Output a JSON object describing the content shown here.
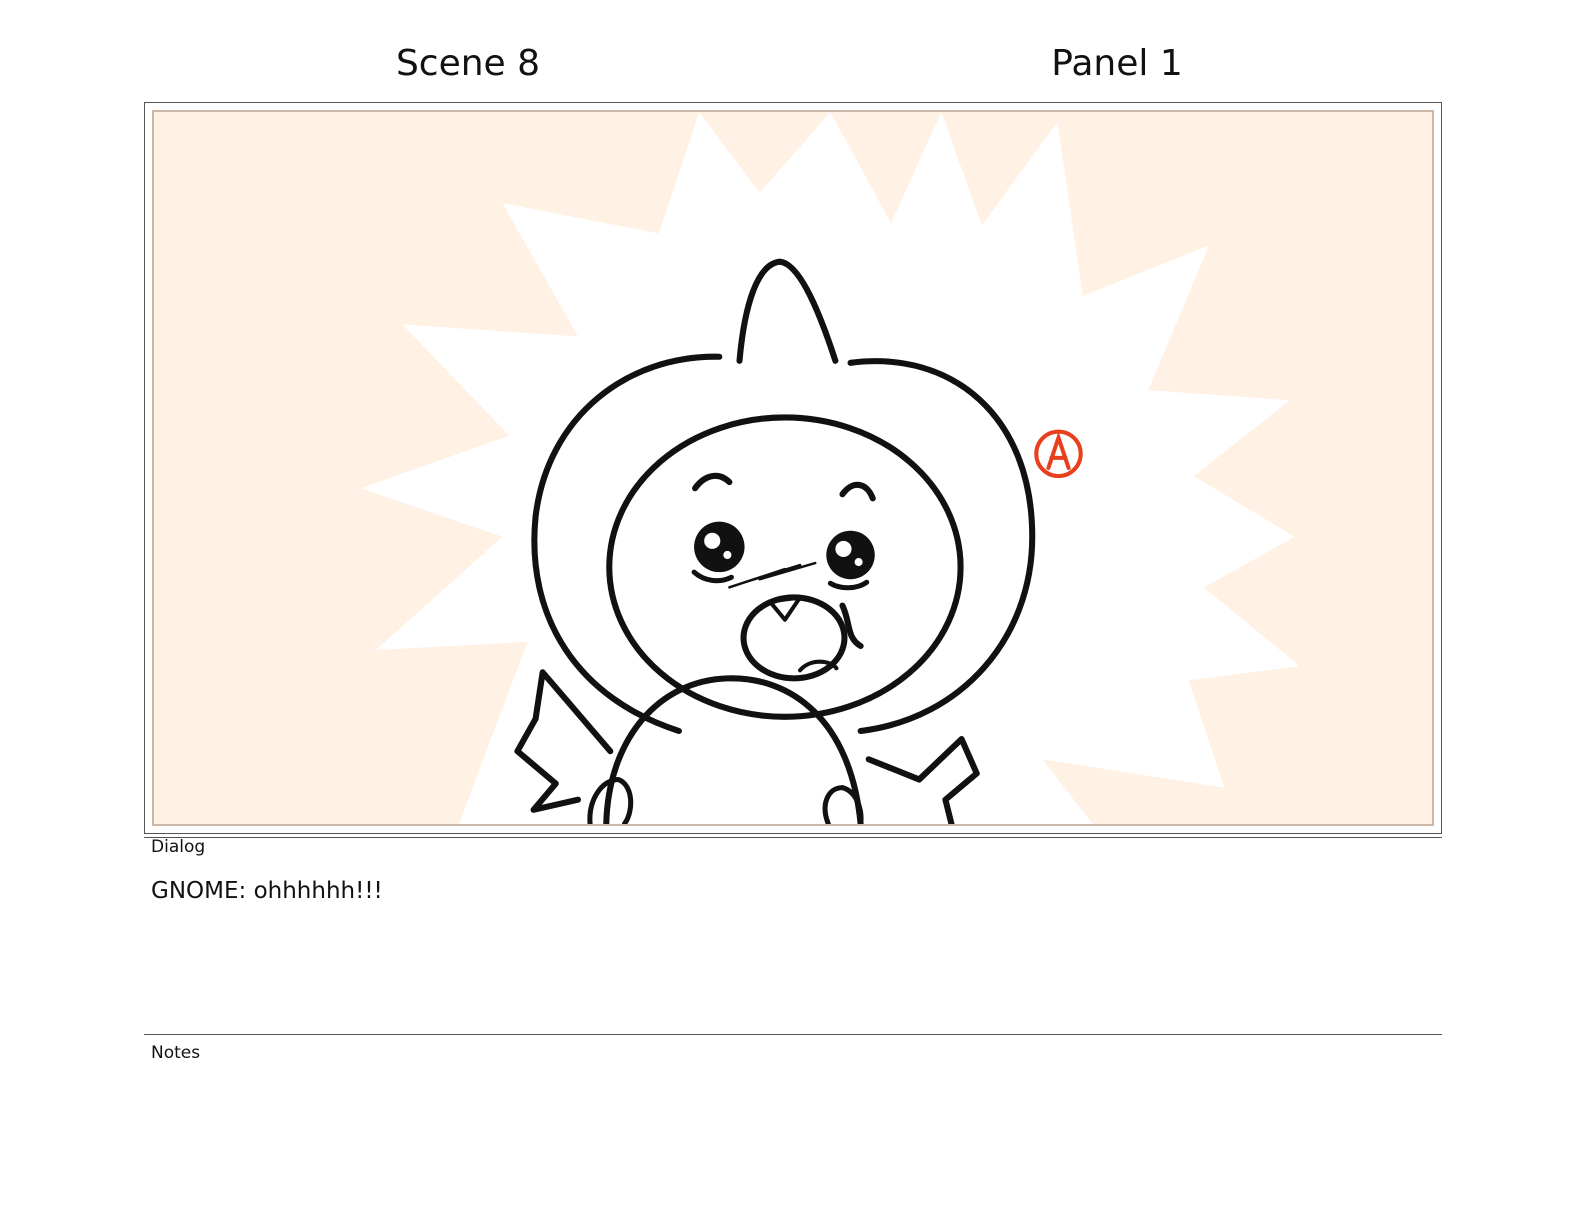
{
  "header": {
    "scene": "Scene 8",
    "panel": "Panel 1"
  },
  "panel_art": {
    "background_color": "#fff1e3",
    "burst_color": "#ffffff",
    "ink_color": "#111111",
    "mark_color": "#e8401c",
    "mark_letter": "A"
  },
  "dialog": {
    "label": "Dialog",
    "text": "GNOME: ohhhhhh!!!"
  },
  "notes": {
    "label": "Notes",
    "text": ""
  }
}
